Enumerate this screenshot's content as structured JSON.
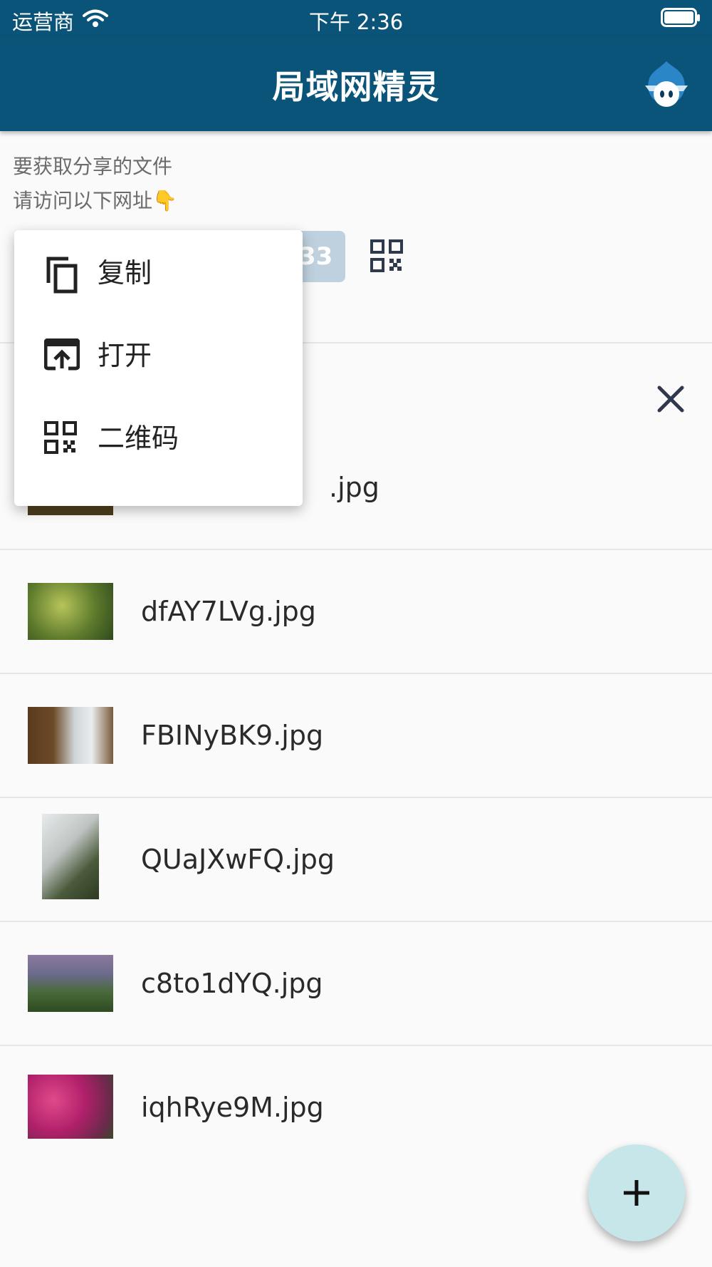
{
  "status_bar": {
    "carrier": "运营商",
    "time": "下午 2:36"
  },
  "app_bar": {
    "title": "局域网精灵"
  },
  "share_info": {
    "line1": "要获取分享的文件",
    "line2": "请访问以下网址",
    "line2_emoji": "👇"
  },
  "url_chip": {
    "visible_text": "33"
  },
  "context_menu": {
    "items": [
      {
        "label": "复制",
        "icon": "copy-icon"
      },
      {
        "label": "打开",
        "icon": "open-in-browser-icon"
      },
      {
        "label": "二维码",
        "icon": "qr-code-icon"
      }
    ]
  },
  "files": [
    {
      "name": ".jpg",
      "thumb": "forest"
    },
    {
      "name": "dfAY7LVg.jpg",
      "thumb": "leaves"
    },
    {
      "name": "FBINyBK9.jpg",
      "thumb": "waterfall-cliff"
    },
    {
      "name": "QUaJXwFQ.jpg",
      "thumb": "waterfall-rocks"
    },
    {
      "name": "c8to1dYQ.jpg",
      "thumb": "waterfall-valley"
    },
    {
      "name": "iqhRye9M.jpg",
      "thumb": "flowers"
    }
  ],
  "colors": {
    "primary": "#0b5479",
    "fab": "#c7e6ea",
    "chip": "#bfd1de",
    "icon_dark": "#2e3a4c"
  }
}
